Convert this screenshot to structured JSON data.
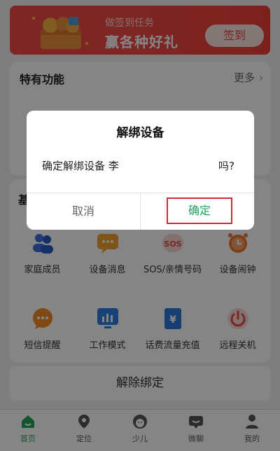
{
  "banner": {
    "subtitle": "做签到任务",
    "title": "赢各种好礼",
    "signin_label": "签到"
  },
  "special": {
    "title": "特有功能",
    "more_label": "更多",
    "more_chevron": "›"
  },
  "basic": {
    "title_fragment": "基"
  },
  "functions": [
    {
      "label": "家庭成员",
      "icon": "family-icon",
      "color": "#3a6de0"
    },
    {
      "label": "设备消息",
      "icon": "message-icon",
      "color": "#f2a12e"
    },
    {
      "label": "SOS/亲情号码",
      "icon": "sos-icon",
      "color": "#e84b43"
    },
    {
      "label": "设备闹钟",
      "icon": "alarm-icon",
      "color": "#f07a2e"
    },
    {
      "label": "短信提醒",
      "icon": "sms-icon",
      "color": "#f58d27"
    },
    {
      "label": "工作模式",
      "icon": "work-mode-icon",
      "color": "#2f7de0"
    },
    {
      "label": "话费流量充值",
      "icon": "recharge-icon",
      "color": "#2b77d8"
    },
    {
      "label": "远程关机",
      "icon": "power-icon",
      "color": "#e84b43"
    }
  ],
  "unbind_label": "解除绑定",
  "tabs": [
    {
      "label": "首页",
      "icon": "home-icon"
    },
    {
      "label": "定位",
      "icon": "location-icon"
    },
    {
      "label": "少儿",
      "icon": "kids-icon"
    },
    {
      "label": "微聊",
      "icon": "chat-icon"
    },
    {
      "label": "我的",
      "icon": "profile-icon"
    }
  ],
  "dialog": {
    "title": "解绑设备",
    "message_left": "确定解绑设备 李",
    "message_right": "吗?",
    "cancel_label": "取消",
    "confirm_label": "确定"
  },
  "colors": {
    "accent": "#23a35a",
    "banner": "#f04842",
    "highlight_box": "#d6292d"
  }
}
